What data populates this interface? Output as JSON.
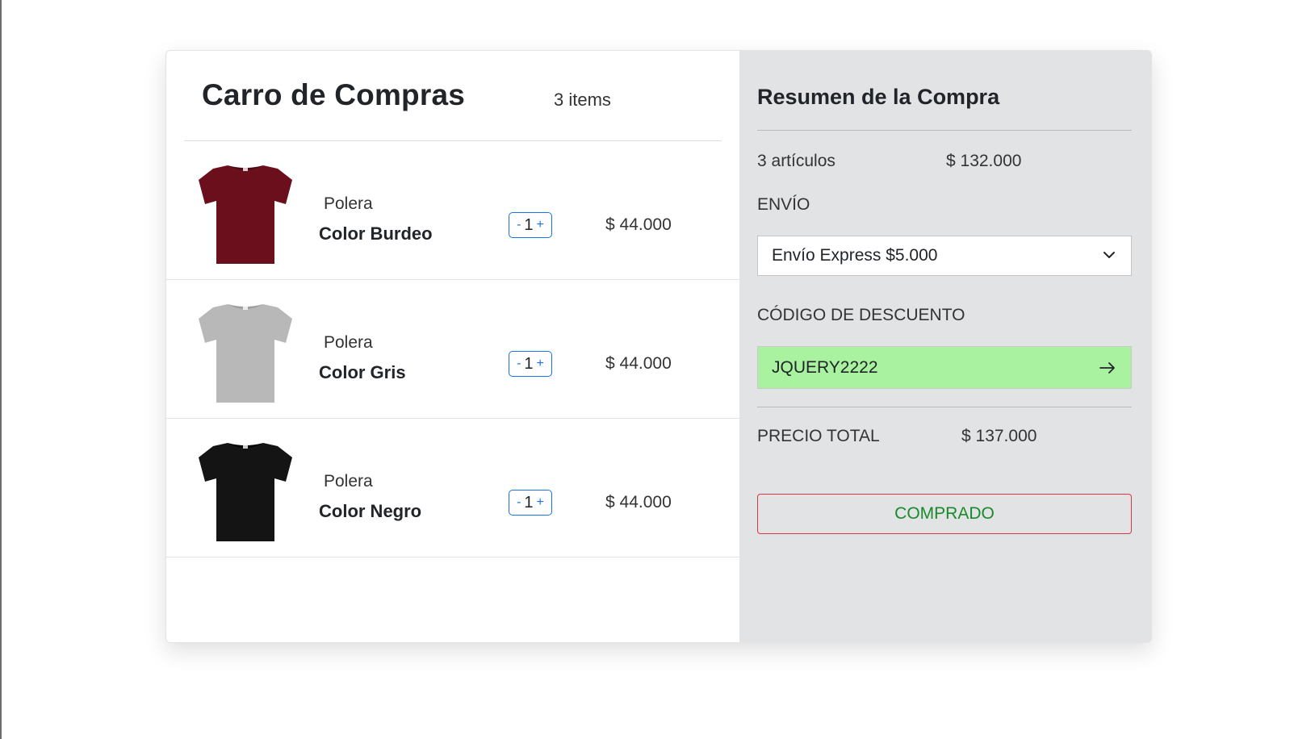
{
  "cart": {
    "title": "Carro de Compras",
    "count_label": "3 items",
    "items": [
      {
        "type": "Polera",
        "name": "Color Burdeo",
        "quantity": "1",
        "decrement_label": "-",
        "increment_label": "+",
        "price": "$ 44.000",
        "shirt_color": "#6b0f1c",
        "collar_color": "#4a0a13"
      },
      {
        "type": "Polera",
        "name": "Color Gris",
        "quantity": "1",
        "decrement_label": "-",
        "increment_label": "+",
        "price": "$ 44.000",
        "shirt_color": "#b8b8b8",
        "collar_color": "#9e9e9e"
      },
      {
        "type": "Polera",
        "name": "Color Negro",
        "quantity": "1",
        "decrement_label": "-",
        "increment_label": "+",
        "price": "$ 44.000",
        "shirt_color": "#141414",
        "collar_color": "#000000"
      }
    ]
  },
  "summary": {
    "title": "Resumen de la Compra",
    "articles_label": "3 artículos",
    "subtotal": "$ 132.000",
    "shipping_label": "ENVÍO",
    "shipping_selected": "Envío Express $5.000",
    "discount_label": "CÓDIGO DE DESCUENTO",
    "discount_code": "JQUERY2222",
    "total_label": "PRECIO TOTAL",
    "total_value": "$ 137.000",
    "buy_button": "COMPRADO"
  },
  "colors": {
    "summary_bg": "#e2e3e5",
    "discount_bg": "#a9f2a0",
    "accent_blue": "#1a73e8",
    "button_border": "#dc3545",
    "button_text": "#198a2a"
  },
  "icons": {
    "shipping_dropdown": "chevron-down-icon",
    "discount_submit": "arrow-right-icon"
  }
}
